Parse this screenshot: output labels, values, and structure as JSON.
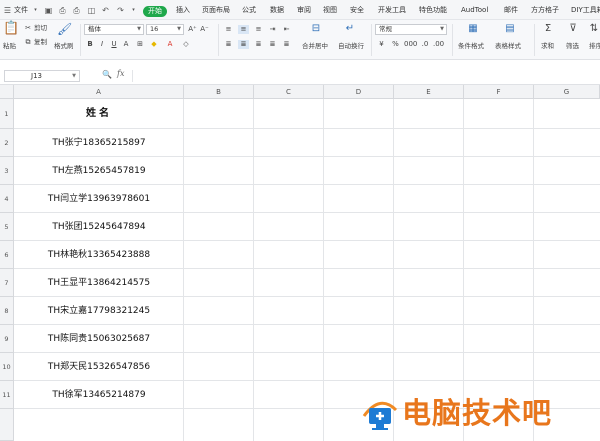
{
  "menubar": {
    "file_label": "文件",
    "tabs": [
      "开始",
      "插入",
      "页面布局",
      "公式",
      "数据",
      "审阅",
      "视图",
      "安全",
      "开发工具",
      "特色功能",
      "AudTool",
      "邮件",
      "方方格子",
      "DIY工具箱"
    ]
  },
  "ribbon": {
    "paste_label": "粘贴",
    "cut_label": "剪切",
    "copy_label": "复制",
    "format_painter_label": "格式刷",
    "font_name": "楷体",
    "font_size": "16",
    "merge_label": "合并居中",
    "wrap_label": "自动换行",
    "number_format": "常规",
    "cond_format_label": "条件格式",
    "table_style_label": "表格样式",
    "sum_label": "求和",
    "filter_label": "筛选",
    "sort_label": "排序"
  },
  "formula_bar": {
    "cell_ref": "J13",
    "fx_label": "fx",
    "value": ""
  },
  "columns": [
    "A",
    "B",
    "C",
    "D",
    "E",
    "F",
    "G"
  ],
  "rows": [
    "1",
    "2",
    "3",
    "4",
    "5",
    "6",
    "7",
    "8",
    "9",
    "10",
    "11"
  ],
  "cells": {
    "A1": "姓名",
    "A2": "TH张宁18365215897",
    "A3": "TH左燕15265457819",
    "A4": "TH闫立学13963978601",
    "A5": "TH张团15245647894",
    "A6": "TH林艳秋13365423888",
    "A7": "TH王显平13864214575",
    "A8": "TH宋立嘉17798321245",
    "A9": "TH陈同贵15063025687",
    "A10": "TH郑天民15326547856",
    "A11": "TH徐军13465214879"
  },
  "watermark": {
    "text": "电脑技术吧",
    "colors": {
      "text": "#e8761c",
      "logo_blue": "#1e7bd4",
      "logo_orange": "#f08a24"
    }
  },
  "colors": {
    "accent_green": "#1fa84b",
    "ribbon_icon_blue": "#2f6fb7",
    "grid_line": "#e3e5e8",
    "header_bg": "#f2f3f5"
  }
}
